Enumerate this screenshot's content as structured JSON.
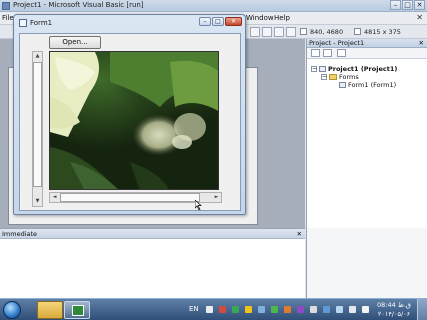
{
  "ide": {
    "title": "Project1 - Microsoft Visual Basic [run]",
    "menu": {
      "file_fragment": "File",
      "window": "Window",
      "help": "Help",
      "close_glyph": "✕"
    },
    "toolbar": {
      "position_readout": "840, 4680",
      "size_readout": "4815 x 375"
    }
  },
  "project": {
    "header": "Project - Project1",
    "close_glyph": "✕",
    "tree": {
      "root": "Project1 (Project1)",
      "folder": "Forms",
      "form": "Form1 (Form1)"
    }
  },
  "immediate": {
    "header": "Immediate",
    "close_glyph": "✕"
  },
  "form1": {
    "title": "Form1",
    "caption_glyphs": {
      "minimize": "–",
      "maximize": "□",
      "close": "✕"
    },
    "open_button": "Open...",
    "scroll_arrows": {
      "up": "▲",
      "down": "▼",
      "left": "◄",
      "right": "►"
    }
  },
  "taskbar": {
    "language": "EN",
    "clock_time": "08:44 ق.ظ",
    "clock_date": "۲۰۱۴/۰۵/۰۶"
  },
  "colors": {
    "accent": "#2c78c8",
    "close_red": "#c7442b"
  }
}
